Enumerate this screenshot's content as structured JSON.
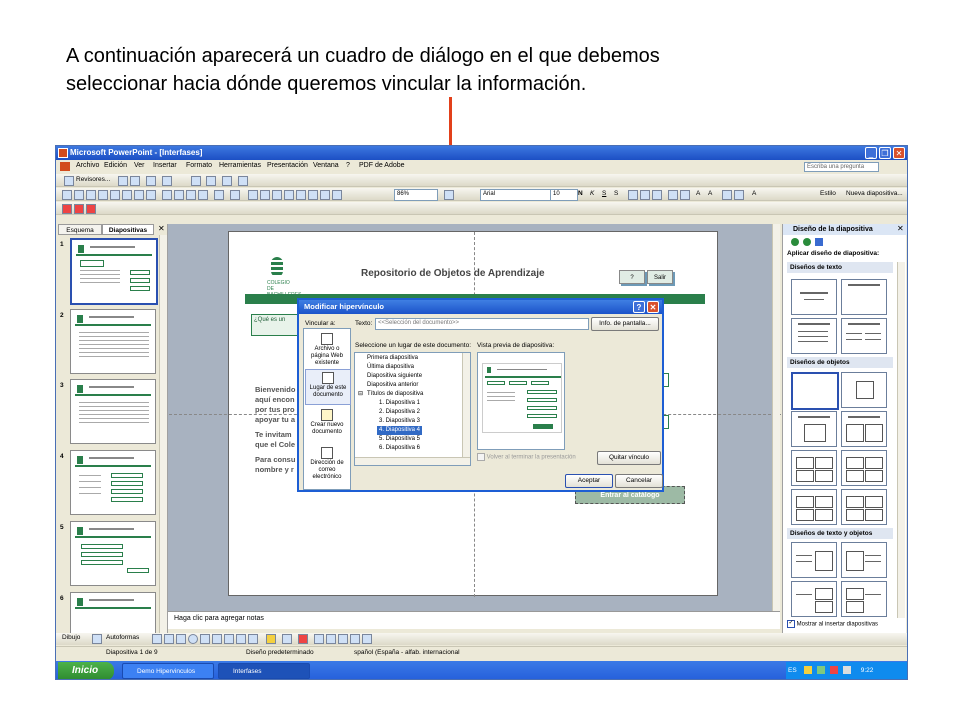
{
  "caption": {
    "line1": "A continuación aparecerá un cuadro de diálogo en el que debemos",
    "line2": "seleccionar hacia dónde queremos vincular la información."
  },
  "colors": {
    "arrow": "#e2401a",
    "xp_blue": "#245edb",
    "slide_green": "#2a7f4b"
  },
  "app": {
    "title": "Microsoft PowerPoint - [Interfases]",
    "menu": [
      "Archivo",
      "Edición",
      "Ver",
      "Insertar",
      "Formato",
      "Herramientas",
      "Presentación",
      "Ventana",
      "?",
      "PDF de Adobe"
    ],
    "ask_placeholder": "Escriba una pregunta",
    "revisores": "Revisores...",
    "zoom": "86%",
    "font": "Arial",
    "font_size": "10",
    "estilo": "Estilo",
    "nueva_diapositiva": "Nueva diapositiva..."
  },
  "left_pane": {
    "tabs": [
      "Esquema",
      "Diapositivas"
    ],
    "slide_numbers": [
      "1",
      "2",
      "3",
      "4",
      "5",
      "6"
    ]
  },
  "slide": {
    "title": "Repositorio de Objetos de Aprendizaje",
    "logo_text": "COLEGIO DE BACHILLERES",
    "help_btn": "?",
    "exit_btn": "Salir",
    "question_box": "¿Qué es un",
    "text1": "Bienvenido",
    "text2": "aquí encon",
    "text3": "por tus pro",
    "text4": "apoyar tu a",
    "text5": "Te invitam",
    "text6": "que el Cole",
    "text7": "Para consu",
    "text8": "nombre y r",
    "enter_btn": "Entrar al catálogo"
  },
  "notes_placeholder": "Haga clic para agregar notas",
  "task_pane": {
    "title": "Diseño de la diapositiva",
    "apply_label": "Aplicar diseño de diapositiva:",
    "sections": [
      "Diseños de texto",
      "Diseños de objetos",
      "Diseños de texto y objetos"
    ],
    "show_checkbox": "Mostrar al insertar diapositivas"
  },
  "draw_toolbar": {
    "dibujo": "Dibujo",
    "autoformas": "Autoformas"
  },
  "status": {
    "slide_info": "Diapositiva 1 de 9",
    "design": "Diseño predeterminado",
    "language": "spañol (España - alfab. internacional"
  },
  "taskbar": {
    "start": "Inicio",
    "tasks": [
      "Demo Hipervinculos",
      "Interfases"
    ],
    "lang": "ES",
    "time": "9:22"
  },
  "dialog": {
    "title": "Modificar hipervínculo",
    "vincular_label": "Vincular a:",
    "texto_label": "Texto:",
    "texto_value": "<<Selección del documento>>",
    "info_btn": "Info. de pantalla...",
    "link_targets": [
      "Archivo o página Web existente",
      "Lugar de este documento",
      "Crear nuevo documento",
      "Dirección de correo electrónico"
    ],
    "place_label": "Seleccione un lugar de este documento:",
    "preview_label": "Vista previa de diapositiva:",
    "tree": [
      "Primera diapositiva",
      "Última diapositiva",
      "Diapositiva siguiente",
      "Diapositiva anterior",
      "Títulos de diapositiva",
      "1. Diapositiva 1",
      "2. Diapositiva 2",
      "3. Diapositiva 3",
      "4. Diapositiva 4",
      "5. Diapositiva 5",
      "6. Diapositiva 6"
    ],
    "return_checkbox": "Volver al terminar la presentación",
    "remove_btn": "Quitar vínculo",
    "ok_btn": "Aceptar",
    "cancel_btn": "Cancelar"
  }
}
